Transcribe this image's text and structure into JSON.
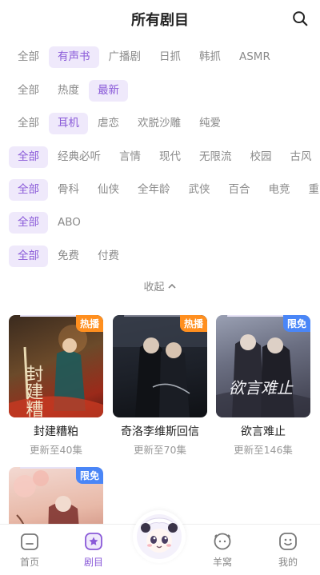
{
  "header": {
    "title": "所有剧目"
  },
  "filters": [
    {
      "items": [
        "全部",
        "有声书",
        "广播剧",
        "日抓",
        "韩抓",
        "ASMR"
      ],
      "active": 1
    },
    {
      "items": [
        "全部",
        "热度",
        "最新"
      ],
      "active": 2
    },
    {
      "items": [
        "全部",
        "耳机",
        "虐恋",
        "欢脱沙雕",
        "纯爱"
      ],
      "active": 1
    },
    {
      "items": [
        "全部",
        "经典必听",
        "言情",
        "现代",
        "无限流",
        "校园",
        "古风"
      ],
      "active": 0
    },
    {
      "items": [
        "全部",
        "骨科",
        "仙侠",
        "全年龄",
        "武侠",
        "百合",
        "电竞",
        "重"
      ],
      "active": 0
    },
    {
      "items": [
        "全部",
        "ABO"
      ],
      "active": 0
    },
    {
      "items": [
        "全部",
        "免费",
        "付费"
      ],
      "active": 0
    }
  ],
  "collapse_label": "收起",
  "cards": [
    {
      "title": "封建糟粕",
      "subtitle": "更新至40集",
      "badge": "热播",
      "badge_type": "hot",
      "cover_art_text": "封建糟粕"
    },
    {
      "title": "奇洛李维斯回信",
      "subtitle": "更新至70集",
      "badge": "热播",
      "badge_type": "hot",
      "cover_art_text": ""
    },
    {
      "title": "欲言难止",
      "subtitle": "更新至146集",
      "badge": "限免",
      "badge_type": "free",
      "cover_art_text": "欲言难止"
    },
    {
      "title": "",
      "subtitle": "",
      "badge": "限免",
      "badge_type": "free",
      "cover_art_text": ""
    }
  ],
  "tabbar": {
    "items": [
      {
        "label": "首页",
        "icon": "home-icon"
      },
      {
        "label": "剧目",
        "icon": "star-icon"
      },
      {
        "label": "",
        "icon": "mascot-avatar"
      },
      {
        "label": "羊窝",
        "icon": "sheep-icon"
      },
      {
        "label": "我的",
        "icon": "smile-icon"
      }
    ],
    "active": 1
  },
  "colors": {
    "accent": "#8a5ad8",
    "chip_active_bg": "#efe9fb",
    "hot_badge": "#ff8f1f",
    "free_badge": "#4a86f7"
  }
}
